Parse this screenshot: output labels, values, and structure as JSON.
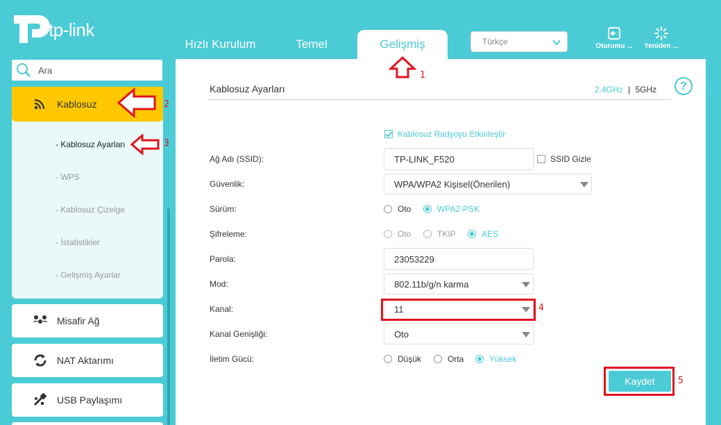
{
  "brand": {
    "name": "tp-link",
    "accent": "#4acbd6",
    "highlight": "#ffc800",
    "annotation": "#e0141c"
  },
  "nav": {
    "tabs": [
      {
        "label": "Hızlı Kurulum"
      },
      {
        "label": "Temel"
      },
      {
        "label": "Gelişmiş",
        "active": true
      }
    ],
    "language": "Türkçe"
  },
  "header_buttons": {
    "logout": {
      "label": "Oturumu ...",
      "icon": "logout-icon"
    },
    "reboot": {
      "label": "Yeniden ...",
      "icon": "reboot-icon"
    }
  },
  "sidebar": {
    "search_placeholder": "Ara",
    "active_item": {
      "label": "Kablosuz",
      "icon": "wifi-icon"
    },
    "sub_items": [
      {
        "label": "- Kablosuz Ayarları",
        "active": true
      },
      {
        "label": "- WPS"
      },
      {
        "label": "- Kablosuz Çizelge"
      },
      {
        "label": "- İstatistikler"
      },
      {
        "label": "- Gelişmiş Ayarlar"
      }
    ],
    "items": [
      {
        "label": "Misafir Ağ",
        "icon": "guest-network-icon"
      },
      {
        "label": "NAT Aktarımı",
        "icon": "nat-forwarding-icon"
      },
      {
        "label": "USB Paylaşımı",
        "icon": "usb-sharing-icon"
      }
    ]
  },
  "main": {
    "section_title": "Kablosuz Ayarları",
    "band_24": "2.4GHz",
    "band_sep": "|",
    "band_5": "5GHz",
    "enable_radio": "Kablosuz Radyoyu Etkinleştir",
    "fields": {
      "ssid": {
        "label": "Ağ Adı (SSID):",
        "value": "TP-LINK_F520",
        "hide_label": "SSID Gizle"
      },
      "security": {
        "label": "Güvenlik:",
        "value": "WPA/WPA2 Kişisel(Önerilen)"
      },
      "version": {
        "label": "Sürüm:",
        "options": [
          "Oto",
          "WPA2-PSK"
        ],
        "selected": "WPA2-PSK"
      },
      "encryption": {
        "label": "Şifreleme:",
        "options": [
          "Oto",
          "TKIP",
          "AES"
        ],
        "selected": "AES"
      },
      "password": {
        "label": "Parola:",
        "value": "23053229"
      },
      "mode": {
        "label": "Mod:",
        "value": "802.11b/g/n karma"
      },
      "channel": {
        "label": "Kanal:",
        "value": "11"
      },
      "channel_width": {
        "label": "Kanal Genişliği:",
        "value": "Oto"
      },
      "tx_power": {
        "label": "İletim Gücü:",
        "options": [
          "Düşük",
          "Orta",
          "Yüksek"
        ],
        "selected": "Yüksek"
      }
    },
    "save_label": "Kaydet"
  },
  "annotations": [
    "1",
    "2",
    "3",
    "4",
    "5"
  ]
}
